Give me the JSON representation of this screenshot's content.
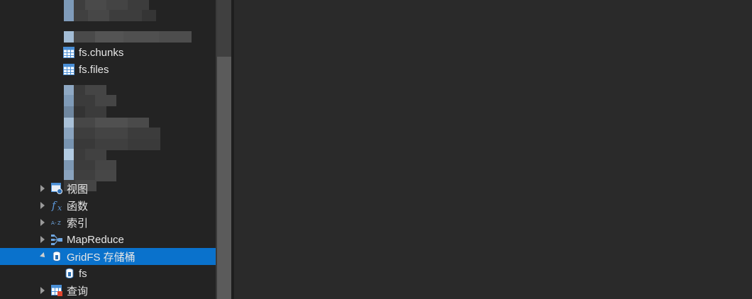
{
  "tree": {
    "collections": [
      {
        "label": "fs.chunks"
      },
      {
        "label": "fs.files"
      }
    ],
    "groups": [
      {
        "label": "视图",
        "icon": "view-icon"
      },
      {
        "label": "函数",
        "icon": "function-icon"
      },
      {
        "label": "索引",
        "icon": "index-icon"
      },
      {
        "label": "MapReduce",
        "icon": "mapreduce-icon"
      },
      {
        "label": "GridFS 存储桶",
        "icon": "gridfs-icon"
      },
      {
        "label": "查询",
        "icon": "query-icon"
      }
    ],
    "gridfs_children": [
      {
        "label": "fs"
      }
    ]
  },
  "colors": {
    "selection": "#0a72cc",
    "panel_bg": "#232323",
    "content_bg": "#2a2a2a",
    "text": "#e6e6e6"
  }
}
